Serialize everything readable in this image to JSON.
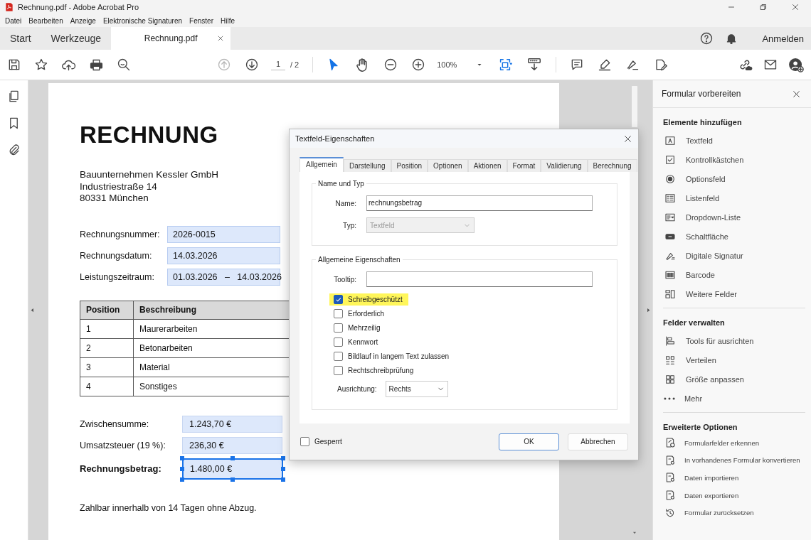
{
  "window": {
    "title": "Rechnung.pdf - Adobe Acrobat Pro"
  },
  "menu": [
    "Datei",
    "Bearbeiten",
    "Anzeige",
    "Elektronische Signaturen",
    "Fenster",
    "Hilfe"
  ],
  "tabs": [
    {
      "label": "Start",
      "selected": false
    },
    {
      "label": "Werkzeuge",
      "selected": false
    },
    {
      "label": "Rechnung.pdf",
      "selected": true
    }
  ],
  "account": {
    "label": "Anmelden"
  },
  "toolbar": {
    "page": "1",
    "page_count": "/ 2",
    "zoom": "100%"
  },
  "document": {
    "title": "RECHNUNG",
    "address": [
      "Bauunternehmen Kessler GmbH",
      "Industriestraße 14",
      "80331 München"
    ],
    "fields": [
      {
        "label": "Rechnungsnummer:",
        "value": "2026-0015"
      },
      {
        "label": "Rechnungsdatum:",
        "value": "14.03.2026"
      },
      {
        "label": "Leistungszeitraum:",
        "value": "01.03.2026   –   14.03.2026"
      }
    ],
    "table": {
      "columns": [
        "Position",
        "Beschreibung"
      ],
      "rows": [
        [
          "1",
          "Maurerarbeiten"
        ],
        [
          "2",
          "Betonarbeiten"
        ],
        [
          "3",
          "Material"
        ],
        [
          "4",
          "Sonstiges"
        ]
      ]
    },
    "totals": [
      {
        "label": "Zwischensumme:",
        "value": "1.243,70 €",
        "emphasized": false,
        "selected": false
      },
      {
        "label": "Umsatzsteuer (19 %):",
        "value": "236,30 €",
        "emphasized": false,
        "selected": false
      },
      {
        "label": "Rechnungsbetrag:",
        "value": "1.480,00 €",
        "emphasized": true,
        "selected": true
      }
    ],
    "note": "Zahlbar innerhalb von 14 Tagen ohne Abzug."
  },
  "dialog": {
    "title": "Textfeld-Eigenschaften",
    "tabs": [
      {
        "label": "Allgemein",
        "selected": true
      },
      {
        "label": "Darstellung",
        "selected": false
      },
      {
        "label": "Position",
        "selected": false
      },
      {
        "label": "Optionen",
        "selected": false
      },
      {
        "label": "Aktionen",
        "selected": false
      },
      {
        "label": "Format",
        "selected": false
      },
      {
        "label": "Validierung",
        "selected": false
      },
      {
        "label": "Berechnung",
        "selected": false
      }
    ],
    "name_group": {
      "title": "Name und Typ",
      "name_label": "Name:",
      "name_value": "rechnungsbetrag",
      "type_label": "Typ:",
      "type_value": "Textfeld",
      "type_disabled": true
    },
    "props_group": {
      "title": "Allgemeine Eigenschaften",
      "tooltip_label": "Tooltip:",
      "checkboxes": [
        {
          "label": "Schreibgeschützt",
          "checked": true,
          "highlighted": true
        },
        {
          "label": "Erforderlich",
          "checked": false,
          "highlighted": false
        },
        {
          "label": "Mehrzeilig",
          "checked": false,
          "highlighted": false
        },
        {
          "label": "Kennwort",
          "checked": false,
          "highlighted": false
        },
        {
          "label": "Bildlauf in langem Text zulassen",
          "checked": false,
          "highlighted": false
        },
        {
          "label": "Rechtschreibprüfung",
          "checked": false,
          "highlighted": false
        }
      ],
      "alignment_label": "Ausrichtung:",
      "alignment_value": "Rechts"
    },
    "locked": {
      "label": "Gesperrt",
      "checked": false
    },
    "buttons": [
      {
        "label": "OK",
        "kind": "primary"
      },
      {
        "label": "Abbrechen",
        "kind": "secondary"
      }
    ]
  },
  "panel": {
    "title": "Formular vorbereiten",
    "sections": [
      {
        "title": "Elemente hinzufügen",
        "items": [
          "Textfeld",
          "Kontrollkästchen",
          "Optionsfeld",
          "Listenfeld",
          "Dropdown-Liste",
          "Schaltfläche",
          "Digitale Signatur",
          "Barcode",
          "Weitere Felder"
        ]
      },
      {
        "title": "Felder verwalten",
        "items": [
          "Tools für ausrichten",
          "Verteilen",
          "Größe anpassen",
          "Mehr"
        ]
      },
      {
        "title": "Erweiterte Optionen",
        "items": [
          "Formularfelder erkennen",
          "In vorhandenes Formular konvertieren",
          "Daten importieren",
          "Daten exportieren",
          "Formular zurücksetzen"
        ]
      }
    ]
  }
}
